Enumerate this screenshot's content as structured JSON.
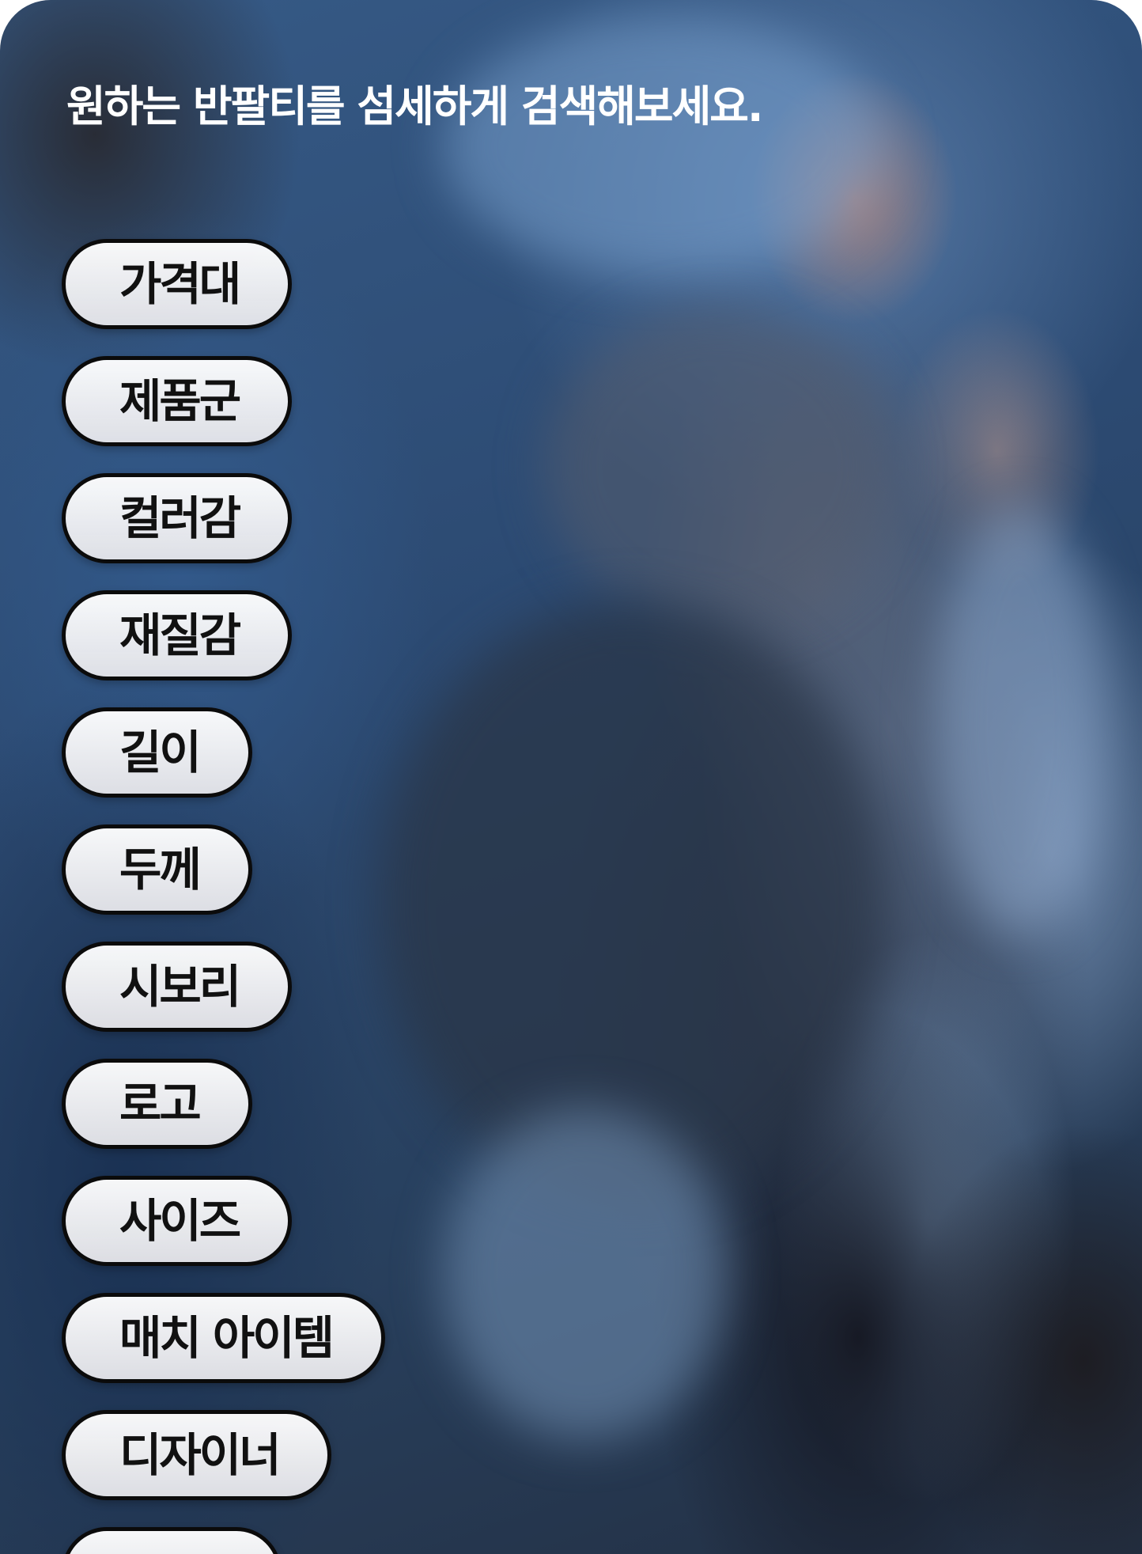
{
  "headline": "원하는 반팔티를 섬세하게 검색해보세요.",
  "filter_chips": [
    {
      "label": "가격대"
    },
    {
      "label": "제품군"
    },
    {
      "label": "컬러감"
    },
    {
      "label": "재질감"
    },
    {
      "label": "길이"
    },
    {
      "label": "두께"
    },
    {
      "label": "시보리"
    },
    {
      "label": "로고"
    },
    {
      "label": "사이즈"
    },
    {
      "label": "매치 아이템"
    },
    {
      "label": "디자이너"
    }
  ],
  "colors": {
    "background_blue": "#2c4a72",
    "chip_border": "#0b0b0b",
    "chip_fill": "#f2f2f4",
    "headline_text": "#ffffff"
  }
}
